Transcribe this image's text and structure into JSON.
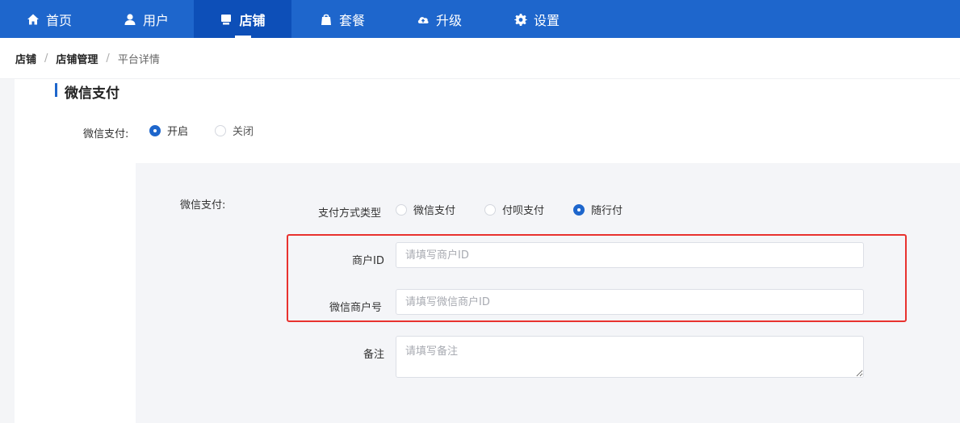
{
  "nav": {
    "items": [
      {
        "label": "首页",
        "icon": "home-icon"
      },
      {
        "label": "用户",
        "icon": "user-icon"
      },
      {
        "label": "店铺",
        "icon": "store-icon",
        "active": true
      },
      {
        "label": "套餐",
        "icon": "bag-icon"
      },
      {
        "label": "升级",
        "icon": "cloud-upload-icon"
      },
      {
        "label": "设置",
        "icon": "gear-icon"
      }
    ]
  },
  "breadcrumb": {
    "items": [
      "店铺",
      "店铺管理",
      "平台详情"
    ],
    "separator": "/"
  },
  "section": {
    "title": "微信支付"
  },
  "toggle": {
    "label": "微信支付:",
    "options": [
      {
        "label": "开启",
        "checked": true
      },
      {
        "label": "关闭",
        "checked": false
      }
    ]
  },
  "panel": {
    "label": "微信支付:",
    "pay_type": {
      "label": "支付方式类型",
      "options": [
        {
          "label": "微信支付",
          "checked": false
        },
        {
          "label": "付呗支付",
          "checked": false
        },
        {
          "label": "随行付",
          "checked": true
        }
      ]
    },
    "merchant_id": {
      "label": "商户ID",
      "value": "",
      "placeholder": "请填写商户ID"
    },
    "wx_merchant_no": {
      "label": "微信商户号",
      "value": "",
      "placeholder": "请填写微信商户ID"
    },
    "remark": {
      "label": "备注",
      "value": "",
      "placeholder": "请填写备注"
    }
  },
  "colors": {
    "primary": "#1e66cc",
    "nav_active": "#0d4fb8",
    "highlight": "#e8322f"
  }
}
